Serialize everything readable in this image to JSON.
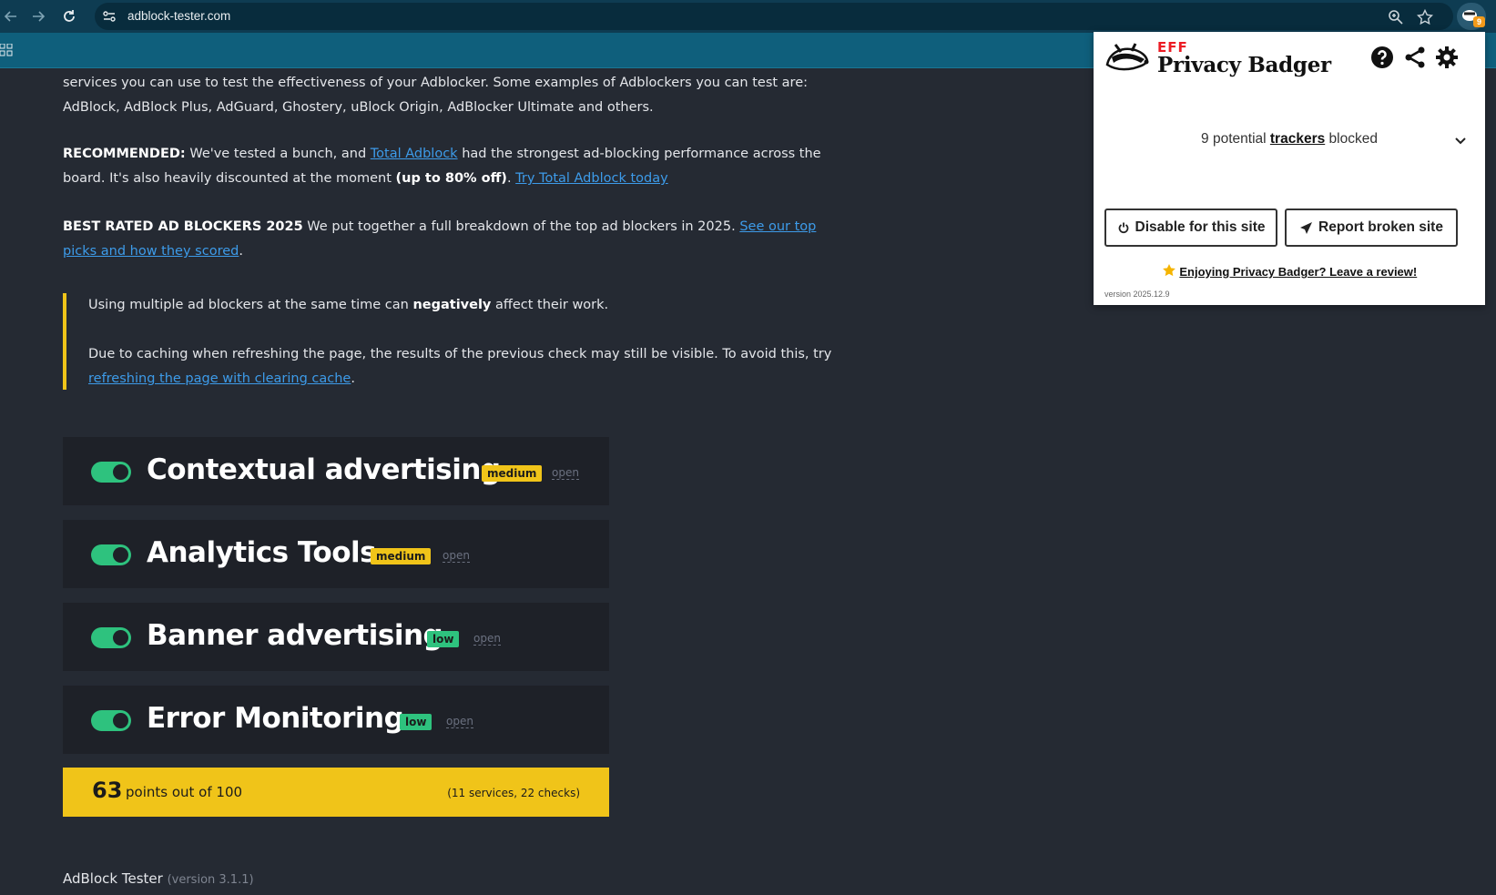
{
  "browser": {
    "url": "adblock-tester.com",
    "extension_badge_count": "9"
  },
  "article": {
    "intro": "services you can use to test the effectiveness of your Adblocker. Some examples of Adblockers you can test are: AdBlock, AdBlock Plus, AdGuard, Ghostery, uBlock Origin, AdBlocker Ultimate and others.",
    "recommended_label": "RECOMMENDED:",
    "recommended_text_1": " We've tested a bunch, and ",
    "recommended_link": "Total Adblock",
    "recommended_text_2": " had the strongest ad-blocking performance across the board. It's also heavily discounted at the moment ",
    "recommended_bold": "(up to 80% off)",
    "recommended_text_3": ". ",
    "recommended_cta": "Try Total Adblock today",
    "best_label": "BEST RATED AD BLOCKERS 2025",
    "best_text": " We put together a full breakdown of the top ad blockers in 2025. ",
    "best_link": "See our top picks and how they scored",
    "best_end": ".",
    "quote_1a": "Using multiple ad blockers at the same time can ",
    "quote_1b": "negatively",
    "quote_1c": " affect their work.",
    "quote_2a": "Due to caching when refreshing the page, the results of the previous check may still be visible. To avoid this, try ",
    "quote_2_link": "refreshing the page with clearing cache",
    "quote_2b": "."
  },
  "checks": [
    {
      "title": "Contextual advertising",
      "severity": "medium",
      "open": "open"
    },
    {
      "title": "Analytics Tools",
      "severity": "medium",
      "open": "open"
    },
    {
      "title": "Banner advertising",
      "severity": "low",
      "open": "open"
    },
    {
      "title": "Error Monitoring",
      "severity": "low",
      "open": "open"
    }
  ],
  "score": {
    "points": "63",
    "label": "points out of 100",
    "meta": "(11 services, 22 checks)"
  },
  "footer": {
    "name": "AdBlock Tester",
    "version": "(version 3.1.1)"
  },
  "popup": {
    "eff": "EFF",
    "name": "Privacy Badger",
    "summary_1": "9 potential ",
    "summary_link": "trackers",
    "summary_2": " blocked",
    "disable_label": "Disable for this site",
    "report_label": "Report broken site",
    "review_label": "Enjoying Privacy Badger? Leave a review!",
    "version": "version 2025.12.9"
  },
  "colors": {
    "page_bg": "#252a33",
    "accent_yellow": "#f0c419",
    "accent_green": "#2ec27e",
    "link_blue": "#3d9be9"
  }
}
